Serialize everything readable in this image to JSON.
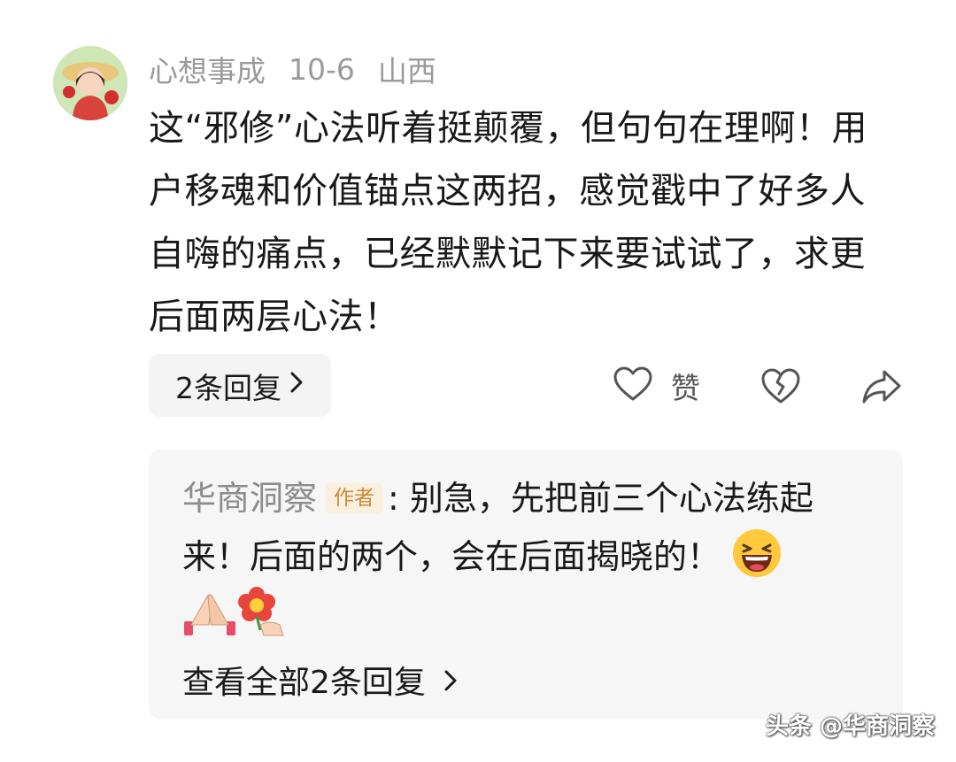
{
  "comment": {
    "username": "心想事成",
    "date": "10-6",
    "location": "山西",
    "text": "这“邪修”心法听着挺颠覆，但句句在理啊！用户移魂和价值锚点这两招，感觉戳中了好多人自嗨的痛点，已经默默记下来要试试了，求更后面两层心法！",
    "replies_button": "2条回复",
    "like_label": "赞"
  },
  "reply": {
    "author": "华商洞察",
    "badge": "作者",
    "text": ": 别急，先把前三个心法练起来！后面的两个，会在后面揭晓的！",
    "emojis": [
      "grinning-face-icon",
      "high-five-hands-icon",
      "giving-flower-icon"
    ],
    "view_all": "查看全部2条回复"
  },
  "watermark": "头条 @华商洞察",
  "icons": {
    "chevron": "chevron-right-icon",
    "like": "heart-outline-icon",
    "dislike": "broken-heart-icon",
    "share": "share-arrow-icon"
  }
}
